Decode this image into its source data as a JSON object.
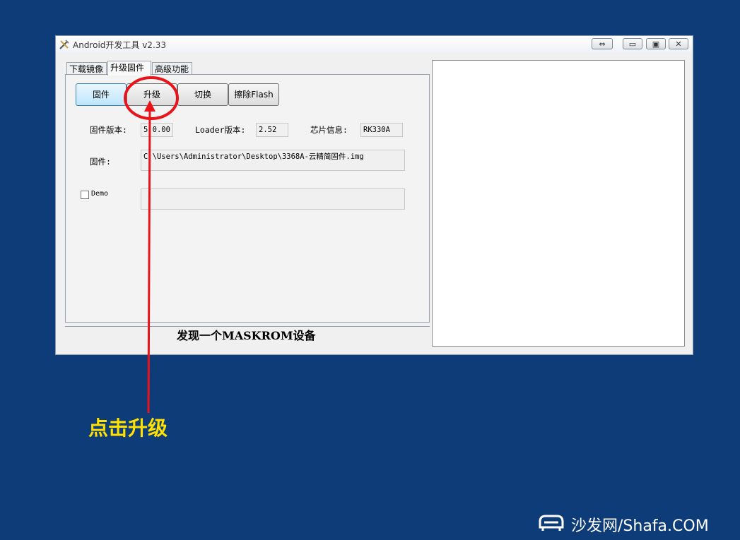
{
  "window": {
    "title": "Android开发工具 v2.33",
    "controls": {
      "swap": "⇔",
      "minimize": "▭",
      "restore": "▣",
      "close": "✕"
    }
  },
  "tabs": [
    {
      "label": "下载镜像",
      "active": false
    },
    {
      "label": "升级固件",
      "active": true
    },
    {
      "label": "高级功能",
      "active": false
    }
  ],
  "toolbar": {
    "firmware_label": "固件",
    "upgrade_label": "升级",
    "switch_label": "切换",
    "erase_label": "擦除Flash"
  },
  "info": {
    "firmware_version_label": "固件版本:",
    "firmware_version_value": "5.0.00",
    "loader_version_label": "Loader版本:",
    "loader_version_value": "2.52",
    "chip_info_label": "芯片信息:",
    "chip_info_value": "RK330A"
  },
  "firmware_path": {
    "label": "固件:",
    "value": "C:\\Users\\Administrator\\Desktop\\3368A-云精简固件.img"
  },
  "demo": {
    "label": "Demo",
    "checked": false,
    "value": ""
  },
  "status": {
    "text": "发现一个MASKROM设备"
  },
  "annotation": {
    "text": "点击升级",
    "color": "#ffe000",
    "highlight_color": "#e8141a"
  },
  "watermark": {
    "text": "沙发网/Shafa.COM"
  },
  "colors": {
    "background": "#0d3c78",
    "window": "#f0f0f0"
  }
}
